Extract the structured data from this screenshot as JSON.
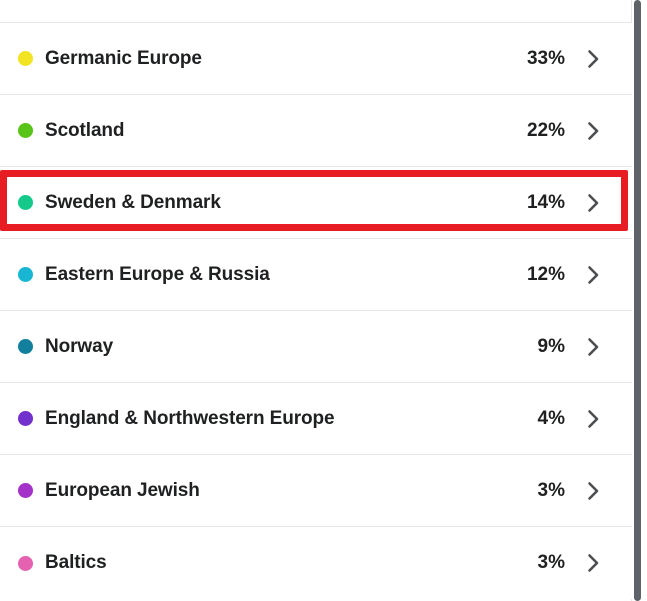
{
  "panel": {
    "name": "ethnicity-estimate-list"
  },
  "rows": [
    {
      "label": "Germanic Europe",
      "percent": "33%",
      "color": "#f2e422",
      "chevron_icon": "chevron-right-icon"
    },
    {
      "label": "Scotland",
      "percent": "22%",
      "color": "#58c319",
      "chevron_icon": "chevron-right-icon"
    },
    {
      "label": "Sweden & Denmark",
      "percent": "14%",
      "color": "#15c98b",
      "chevron_icon": "chevron-right-icon"
    },
    {
      "label": "Eastern Europe & Russia",
      "percent": "12%",
      "color": "#19b6d4",
      "chevron_icon": "chevron-right-icon"
    },
    {
      "label": "Norway",
      "percent": "9%",
      "color": "#12809c",
      "chevron_icon": "chevron-right-icon"
    },
    {
      "label": "England & Northwestern Europe",
      "percent": "4%",
      "color": "#7230cc",
      "chevron_icon": "chevron-right-icon"
    },
    {
      "label": "European Jewish",
      "percent": "3%",
      "color": "#a432c8",
      "chevron_icon": "chevron-right-icon"
    },
    {
      "label": "Baltics",
      "percent": "3%",
      "color": "#e462b0",
      "chevron_icon": "chevron-right-icon"
    }
  ],
  "annotation": {
    "target_row_label": "Sweden & Denmark",
    "box_color": "#e81d23"
  },
  "scrollbar": {
    "thumb_color": "#5f6368"
  }
}
